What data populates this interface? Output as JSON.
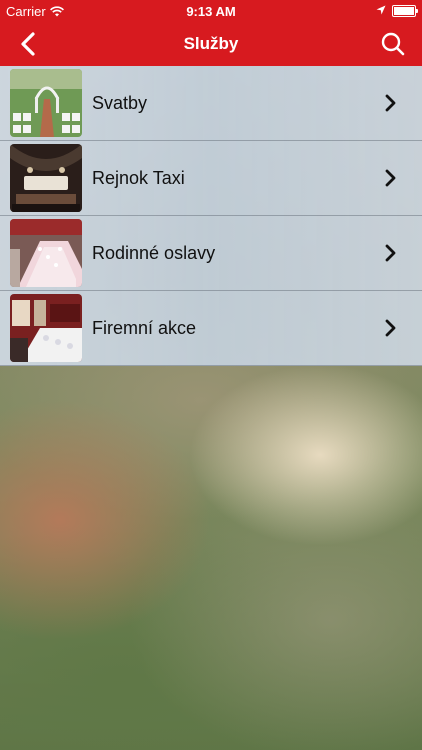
{
  "status_bar": {
    "carrier": "Carrier",
    "time": "9:13 AM"
  },
  "nav": {
    "title": "Služby",
    "back_icon": "chevron-left-icon",
    "search_icon": "search-icon"
  },
  "colors": {
    "brand_red": "#d71a1f"
  },
  "services": [
    {
      "label": "Svatby",
      "thumb": "wedding-arch-photo"
    },
    {
      "label": "Rejnok Taxi",
      "thumb": "taxi-interior-photo"
    },
    {
      "label": "Rodinné oslavy",
      "thumb": "family-table-photo"
    },
    {
      "label": "Firemní akce",
      "thumb": "corporate-hall-photo"
    }
  ]
}
